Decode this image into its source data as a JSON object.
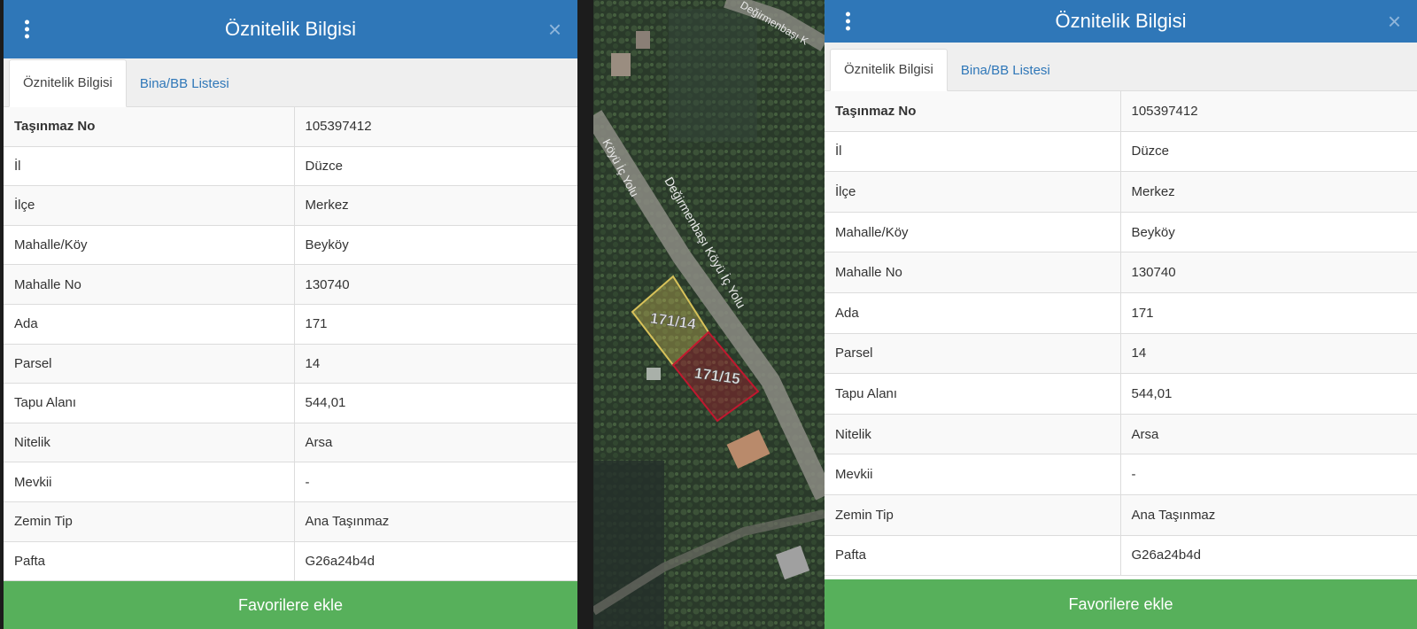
{
  "panels": [
    {
      "title": "Öznitelik Bilgisi",
      "close_glyph": "×",
      "tabs": [
        {
          "label": "Öznitelik Bilgisi",
          "active": true
        },
        {
          "label": "Bina/BB Listesi",
          "active": false
        }
      ],
      "rows": [
        {
          "key": "Taşınmaz No",
          "value": "105397412"
        },
        {
          "key": "İl",
          "value": "Düzce"
        },
        {
          "key": "İlçe",
          "value": "Merkez"
        },
        {
          "key": "Mahalle/Köy",
          "value": "Beyköy"
        },
        {
          "key": "Mahalle No",
          "value": "130740"
        },
        {
          "key": "Ada",
          "value": "171"
        },
        {
          "key": "Parsel",
          "value": "14"
        },
        {
          "key": "Tapu Alanı",
          "value": "544,01"
        },
        {
          "key": "Nitelik",
          "value": "Arsa"
        },
        {
          "key": "Mevkii",
          "value": "-"
        },
        {
          "key": "Zemin Tip",
          "value": "Ana Taşınmaz"
        },
        {
          "key": "Pafta",
          "value": "G26a24b4d"
        }
      ],
      "favorite_label": "Favorilere ekle"
    },
    {
      "title": "Öznitelik Bilgisi",
      "close_glyph": "×",
      "tabs": [
        {
          "label": "Öznitelik Bilgisi",
          "active": true
        },
        {
          "label": "Bina/BB Listesi",
          "active": false
        }
      ],
      "rows": [
        {
          "key": "Taşınmaz No",
          "value": "105397412"
        },
        {
          "key": "İl",
          "value": "Düzce"
        },
        {
          "key": "İlçe",
          "value": "Merkez"
        },
        {
          "key": "Mahalle/Köy",
          "value": "Beyköy"
        },
        {
          "key": "Mahalle No",
          "value": "130740"
        },
        {
          "key": "Ada",
          "value": "171"
        },
        {
          "key": "Parsel",
          "value": "14"
        },
        {
          "key": "Tapu Alanı",
          "value": "544,01"
        },
        {
          "key": "Nitelik",
          "value": "Arsa"
        },
        {
          "key": "Mevkii",
          "value": "-"
        },
        {
          "key": "Zemin Tip",
          "value": "Ana Taşınmaz"
        },
        {
          "key": "Pafta",
          "value": "G26a24b4d"
        }
      ],
      "favorite_label": "Favorilere ekle"
    }
  ],
  "map": {
    "road_labels": [
      "Değirmenbaşı Köyü İç Yolu",
      "Köyü İç Yolu",
      "Değirmenbaşı K"
    ],
    "parcels": [
      {
        "label": "171/14",
        "color": "#d8c25a"
      },
      {
        "label": "171/15",
        "color": "#c0182f"
      }
    ]
  }
}
